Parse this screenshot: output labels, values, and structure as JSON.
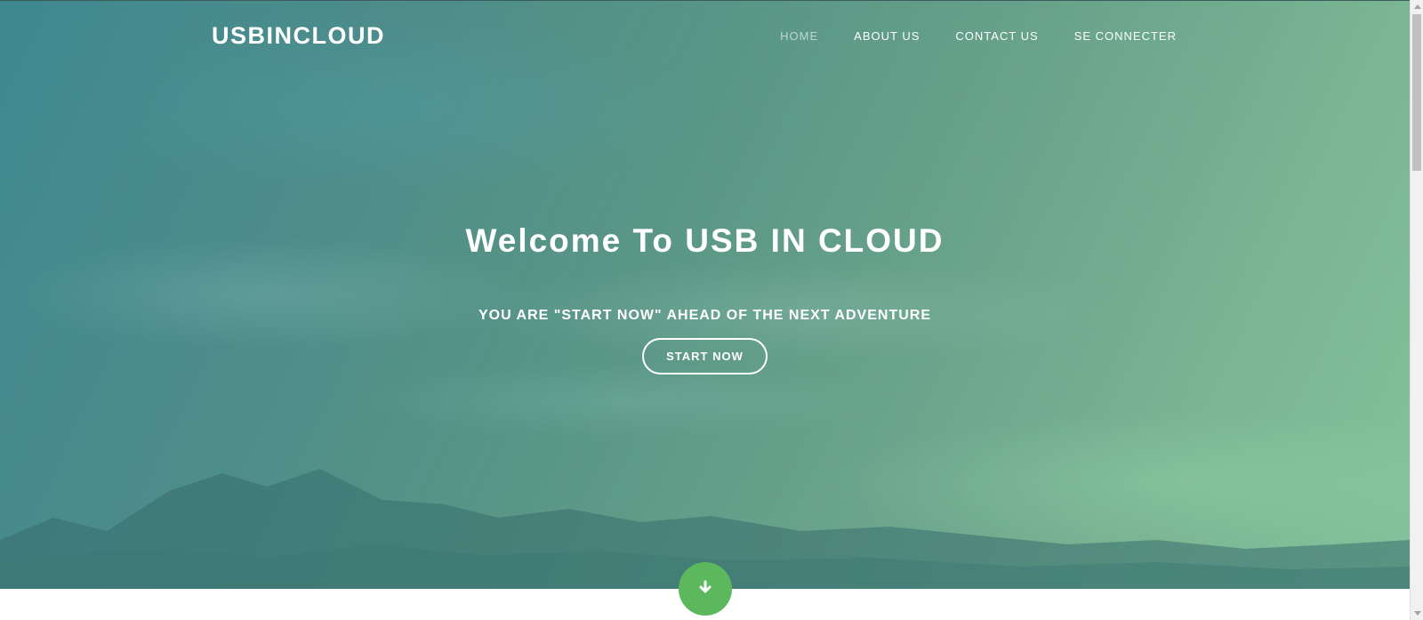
{
  "site": {
    "brand": "USBINCLOUD"
  },
  "nav": {
    "items": [
      {
        "label": "HOME",
        "active": true
      },
      {
        "label": "ABOUT US",
        "active": false
      },
      {
        "label": "CONTACT US",
        "active": false
      },
      {
        "label": "SE CONNECTER",
        "active": false
      }
    ]
  },
  "hero": {
    "headline": "Welcome To USB IN CLOUD",
    "subline": "YOU ARE \"START NOW\" AHEAD OF THE NEXT ADVENTURE",
    "cta_label": "START NOW",
    "scroll_icon": "arrow-down-icon"
  },
  "colors": {
    "accent_green": "#5cb85c",
    "text_white": "#ffffff",
    "nav_active": "rgba(255,255,255,0.6)"
  }
}
